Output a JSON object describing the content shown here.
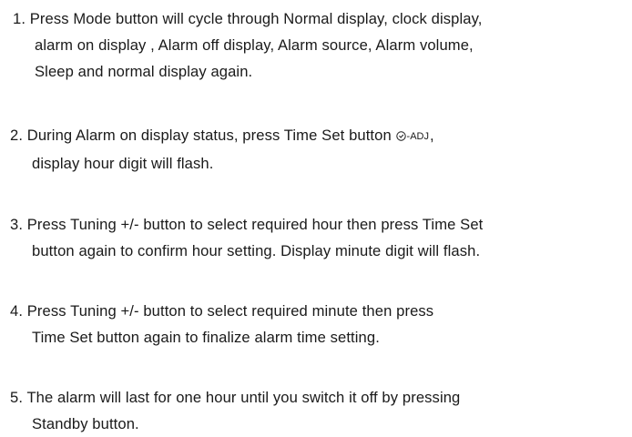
{
  "steps": [
    {
      "lines": [
        "1. Press Mode button will cycle through Normal display, clock display,",
        "alarm on display , Alarm off display, Alarm source, Alarm volume,",
        "Sleep and normal display again."
      ]
    },
    {
      "line1_before": "2. During Alarm on display status, press Time Set button",
      "timeset_label": "-ADJ",
      "line1_after": ",",
      "lines": [
        "display hour digit will flash."
      ]
    },
    {
      "lines": [
        "3. Press Tuning +/- button to select required hour then press Time Set",
        "button again to confirm hour setting. Display minute digit will flash."
      ]
    },
    {
      "lines": [
        "4. Press Tuning +/- button to select required minute then press",
        "Time Set button again to finalize alarm time setting."
      ]
    },
    {
      "lines": [
        "5. The alarm will last for one hour until you switch it off by pressing",
        "Standby button."
      ]
    }
  ]
}
